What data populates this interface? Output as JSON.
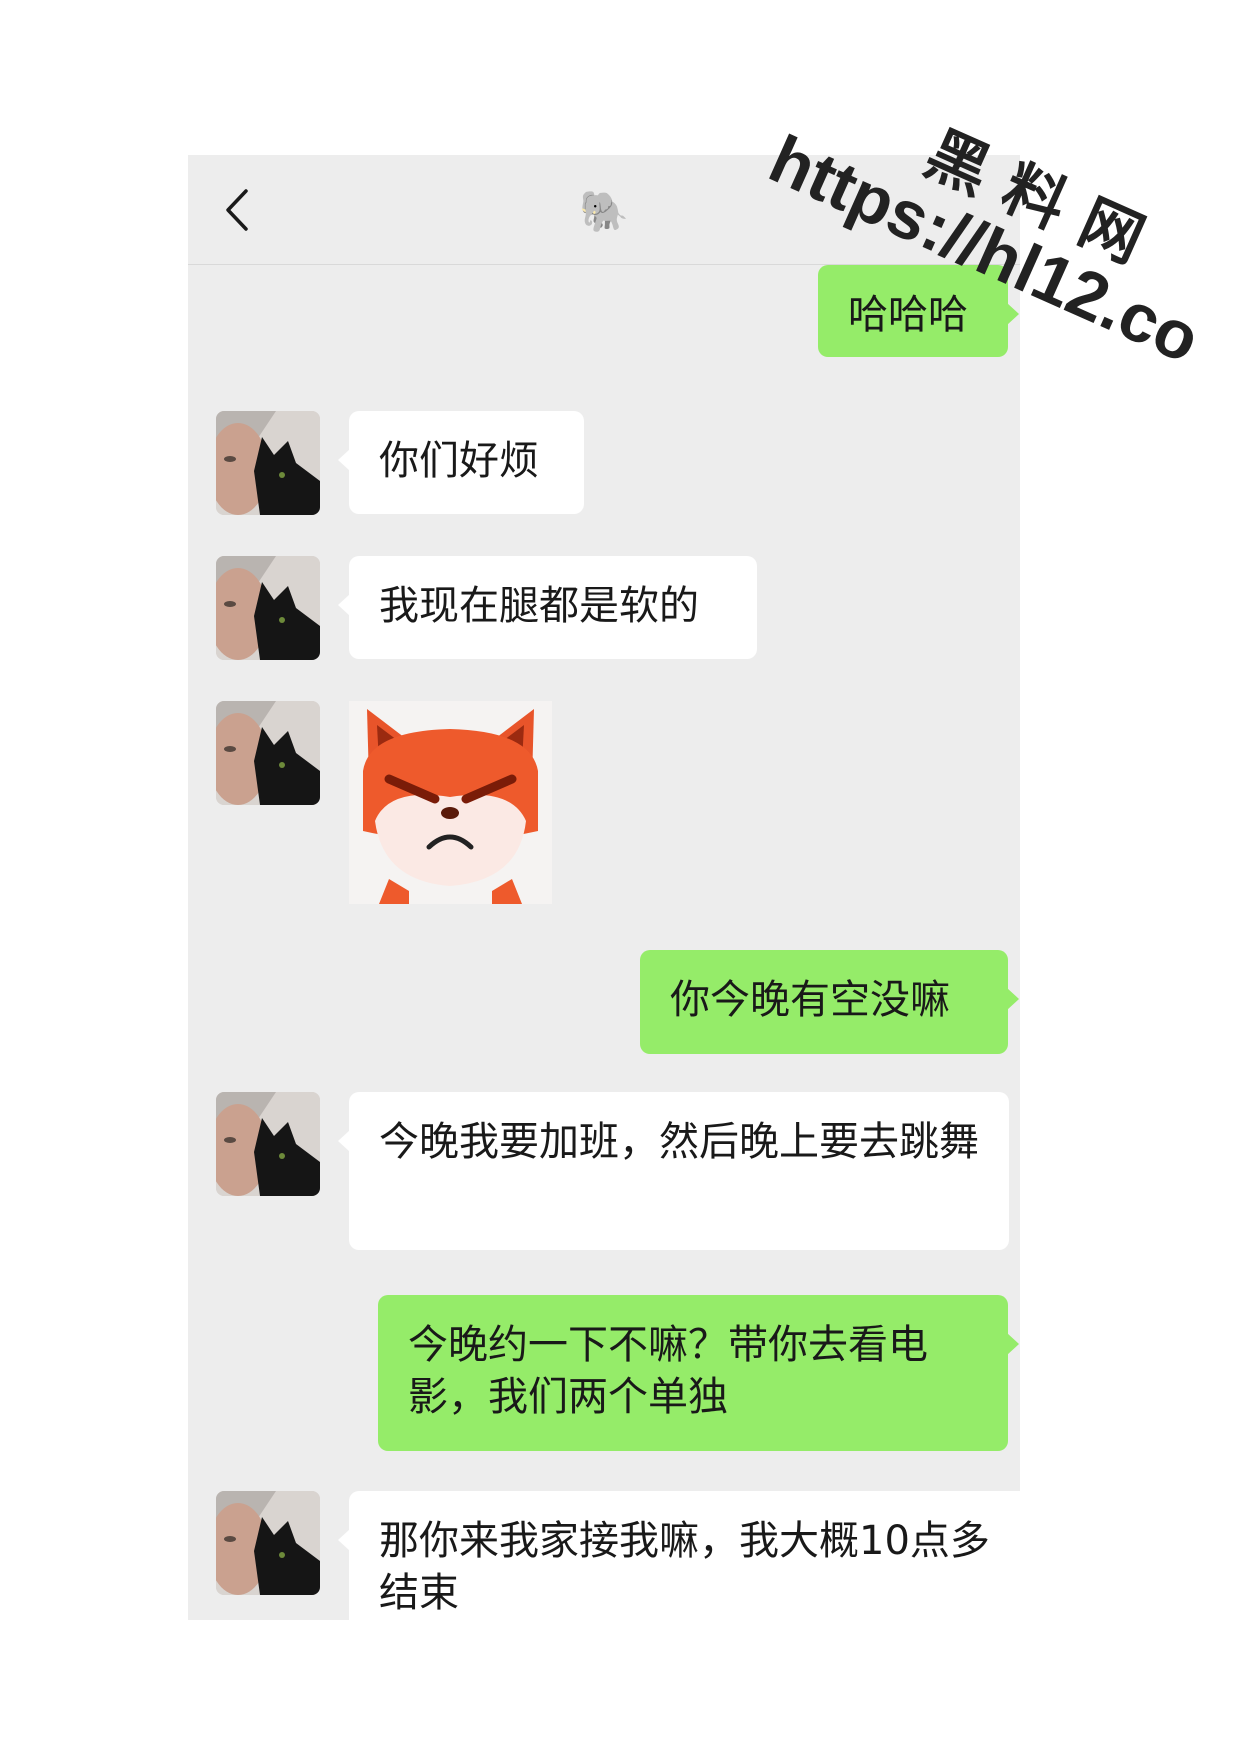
{
  "header": {
    "title": "🐘",
    "back_icon": "chevron-left-icon"
  },
  "messages": [
    {
      "side": "out",
      "type": "text",
      "text": "哈哈哈"
    },
    {
      "side": "in",
      "type": "text",
      "text": "你们好烦"
    },
    {
      "side": "in",
      "type": "text",
      "text": "我现在腿都是软的"
    },
    {
      "side": "in",
      "type": "sticker",
      "sticker": "angry-fox-sticker"
    },
    {
      "side": "out",
      "type": "text",
      "text": "你今晚有空没嘛"
    },
    {
      "side": "in",
      "type": "text",
      "text": "今晚我要加班，然后晚上要去跳舞"
    },
    {
      "side": "out",
      "type": "text",
      "text": "今晚约一下不嘛？带你去看电影，我们两个单独"
    },
    {
      "side": "in",
      "type": "text",
      "text": "那你来我家接我嘛，我大概10点多结束"
    }
  ],
  "watermark": {
    "site_name": "黑料网",
    "url": "https://hl12.co"
  },
  "colors": {
    "chat_background": "#ededed",
    "incoming_bubble": "#ffffff",
    "outgoing_bubble": "#95ec69"
  }
}
